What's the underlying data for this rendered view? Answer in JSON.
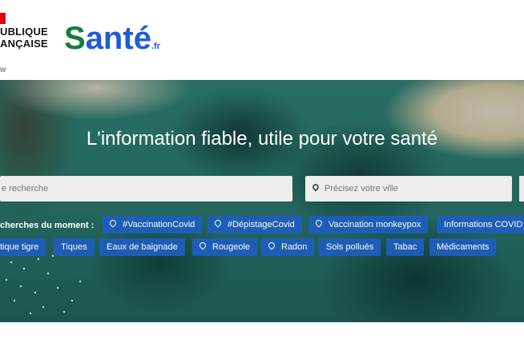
{
  "header": {
    "republic_line1": "UBLIQUE",
    "republic_line2": "ANÇAISE",
    "republic_tag": "w",
    "logo_s": "S",
    "logo_rest": "anté",
    "logo_suffix": ".fr",
    "colors": {
      "flag_red": "#e1000f",
      "logo_green": "#1b7a43",
      "logo_blue": "#1f5bd6"
    }
  },
  "hero": {
    "title": "L'information fiable, utile pour votre santé",
    "search": {
      "placeholder": "e recherche"
    },
    "city": {
      "placeholder": "Précisez votre ville",
      "icon": "location-pin-icon"
    },
    "trending_label": "cherches du moment :",
    "chips_row1": [
      {
        "label": "#VaccinationCovid",
        "icon": "location-pin-icon"
      },
      {
        "label": "#DépistageCovid",
        "icon": "location-pin-icon"
      },
      {
        "label": "Vaccination monkeypox",
        "icon": "location-pin-icon"
      },
      {
        "label": "Informations COVID",
        "icon": ""
      }
    ],
    "chips_row2": [
      {
        "label": "tique tigre",
        "icon": ""
      },
      {
        "label": "Tiques",
        "icon": ""
      },
      {
        "label": "Eaux de baignade",
        "icon": ""
      },
      {
        "label": "Rougeole",
        "icon": "location-pin-icon"
      },
      {
        "label": "Radon",
        "icon": "location-pin-icon"
      },
      {
        "label": "Sols pollués",
        "icon": ""
      },
      {
        "label": "Tabac",
        "icon": ""
      },
      {
        "label": "Médicaments",
        "icon": ""
      }
    ],
    "colors": {
      "chip_bg": "#1d5db5",
      "water": "#2f7d72"
    }
  }
}
